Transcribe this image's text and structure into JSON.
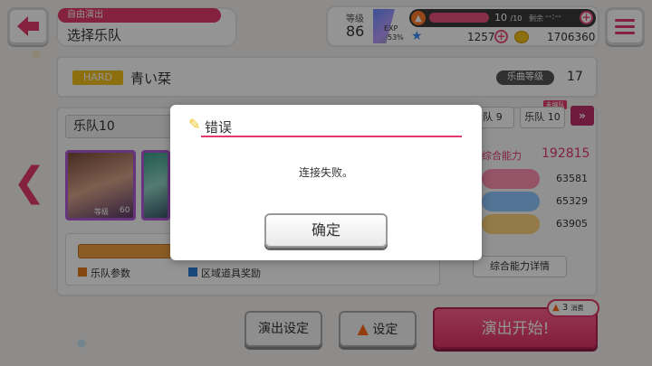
{
  "header": {
    "mode_tag": "自由演出",
    "mode_title": "选择乐队",
    "level_label": "等级",
    "level_value": "86",
    "exp_label": "EXP",
    "exp_percent": "53%",
    "stamina": "10",
    "stamina_max": "/10",
    "remain_label": "剩余",
    "remain_value": "--:--",
    "star_value": "1257",
    "coin_value": "1706360"
  },
  "song": {
    "difficulty": "HARD",
    "title": "青い栞",
    "level_label": "乐曲等级",
    "level_value": "17"
  },
  "band": {
    "name": "乐队10",
    "card_level_label": "等级",
    "card_level_value": "60",
    "band_tab_prefix": "队",
    "band_tab_value": "9",
    "band_tab2_label": "乐队",
    "band_tab2_value": "10",
    "new_tag": "未编队",
    "next_icon": "»"
  },
  "stats": {
    "power_label": "综合能力",
    "power_value": "192815",
    "values": [
      {
        "value": "63581",
        "color": "#ff8fb0"
      },
      {
        "value": "65329",
        "color": "#8fc8ff"
      },
      {
        "value": "63905",
        "color": "#ffd37a"
      }
    ],
    "detail_button": "综合能力详情"
  },
  "legend": {
    "band_param": "乐队参数",
    "area_item": "区域道具奖励"
  },
  "bottom": {
    "perform_settings": "演出设定",
    "settings": "设定",
    "start": "演出开始!",
    "cost_value": "3",
    "cost_label": "消费"
  },
  "dialog": {
    "title": "错误",
    "message": "连接失败。",
    "ok": "确定"
  }
}
